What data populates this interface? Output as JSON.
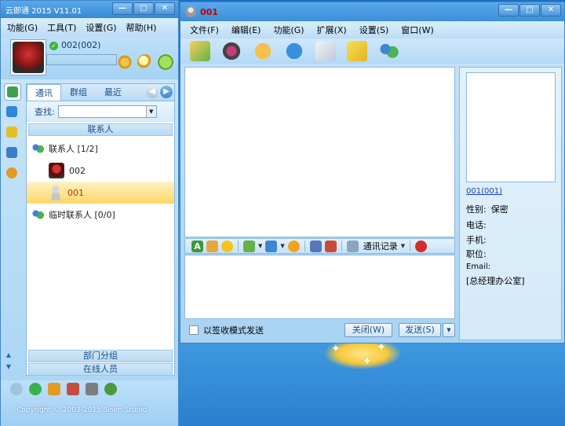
{
  "client": {
    "title": "云即通 2015  V11.01",
    "caption": {
      "min": "—",
      "max": "□",
      "close": "✕"
    },
    "menu": [
      "功能(G)",
      "工具(T)",
      "设置(G)",
      "帮助(H)"
    ],
    "profile": {
      "name": "002(002)"
    },
    "tabs": [
      "通讯",
      "群组",
      "最近"
    ],
    "search_label": "查找:",
    "contacts_header": "联系人",
    "tree": [
      {
        "label": "联系人 [1/2]",
        "kind": "group"
      },
      {
        "label": "002",
        "kind": "contact"
      },
      {
        "label": "001",
        "kind": "contact",
        "selected": true
      },
      {
        "label": "临时联系人 [0/0]",
        "kind": "group"
      }
    ],
    "bottom_groups": [
      "部门分组",
      "在线人员"
    ],
    "copyright": "Copyright © 2003-2015 Sisen Studio"
  },
  "chat": {
    "title_name": "001",
    "caption": {
      "min": "—",
      "max": "□",
      "close": "✕"
    },
    "menu": [
      "文件(F)",
      "编辑(E)",
      "功能(G)",
      "扩展(X)",
      "设置(S)",
      "窗口(W)"
    ],
    "history_label": "通讯记录",
    "receipt_label": "以签收模式发送",
    "close_btn": "关闭(W)",
    "send_btn": "发送(S)",
    "send_drop": "▼",
    "info": {
      "link": "001(001)",
      "gender_label": "性别:",
      "gender_value": "保密",
      "phone_label": "电话:",
      "mobile_label": "手机:",
      "title_label": "职位:",
      "email_label": "Email:",
      "dept": "[总经理办公室]"
    }
  },
  "colors": {
    "accent": "#3589d6",
    "selected_text": "#c43000",
    "title_red": "#c20000"
  }
}
